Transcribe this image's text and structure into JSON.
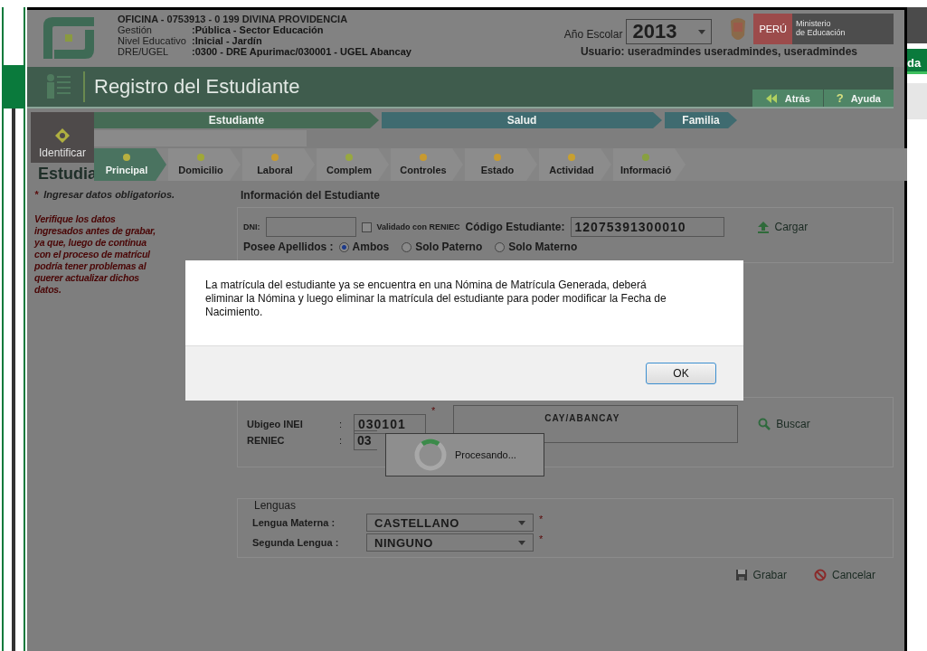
{
  "background_page": {
    "tab_text": "da"
  },
  "header": {
    "office": "OFICINA - 0753913 - 0  199 DIVINA PROVIDENCIA",
    "info": [
      {
        "label": "Gestión",
        "value": ":Pública - Sector Educación"
      },
      {
        "label": "Nivel Educativo",
        "value": ":Inicial - Jardín"
      },
      {
        "label": "DRE/UGEL",
        "value": ":0300 - DRE Apurimac/030001 - UGEL Abancay"
      }
    ],
    "year_label": "Año Escolar",
    "year": "2013",
    "logo_country": "PERÚ",
    "logo_ministry": [
      "Ministerio",
      "de Educación"
    ],
    "user": "Usuario: useradmindes useradmindes, useradmindes"
  },
  "title_bar": {
    "title": "Registro del Estudiante",
    "buttons": [
      {
        "label": "Atrás",
        "kind": "back"
      },
      {
        "label": "Ayuda",
        "kind": "help",
        "icon_text": "?"
      }
    ]
  },
  "stages": [
    {
      "label": "Estudiante",
      "selected": true
    },
    {
      "label": "Salud",
      "selected": false
    },
    {
      "label": "Familia",
      "selected": false
    }
  ],
  "identify": {
    "label": "Identificar"
  },
  "tabs": [
    {
      "label": "Principal",
      "selected": true,
      "color": "#b8b040"
    },
    {
      "label": "Domicilio",
      "selected": false,
      "color": "#a0a838"
    },
    {
      "label": "Laboral",
      "selected": false,
      "color": "#c89a30"
    },
    {
      "label": "Complem",
      "selected": false,
      "color": "#98a840"
    },
    {
      "label": "Controles",
      "selected": false,
      "color": "#c89a30"
    },
    {
      "label": "Estado",
      "selected": false,
      "color": "#c89a30"
    },
    {
      "label": "Actividad",
      "selected": false,
      "color": "#c8a030"
    },
    {
      "label": "Informació",
      "selected": false,
      "color": "#88a040"
    }
  ],
  "heading": "Estudia",
  "notes": {
    "mark": "*",
    "required": "Ingresar datos obligatorios.",
    "warning": "Verifique los datos\ningresados antes de grabar,\nya que, luego de continua\ncon el proceso de matrícul\npodría tener problemas al\nquerer actualizar dichos\ndatos."
  },
  "form": {
    "section_title": "Información del Estudiante",
    "dni_label": "DNI:",
    "reniec_check": {
      "label": "Validado con RENIEC",
      "checked": false
    },
    "code_label": "Código Estudiante:",
    "code": "12075391300010",
    "load_button": "Cargar",
    "surnames_label": "Posee Apellidos  :",
    "surname_options": [
      {
        "label": "Ambos",
        "selected": true
      },
      {
        "label": "Solo Paterno",
        "selected": false
      },
      {
        "label": "Solo Materno",
        "selected": false
      }
    ],
    "ubigeo_label": "Ubigeo INEI",
    "ubigeo": "030101",
    "place": "CAY/ABANCAY",
    "reniec_label": "RENIEC",
    "reniec": "03",
    "search_button": "Buscar",
    "languages_title": "Lenguas",
    "languages": [
      {
        "label": "Lengua Materna  :",
        "value": "CASTELLANO"
      },
      {
        "label": "Segunda Lengua  :",
        "value": "NINGUNO"
      }
    ],
    "required_mark": "*",
    "colon": ":",
    "save_button": "Grabar",
    "cancel_button": "Cancelar"
  },
  "dialog": {
    "message": "La matrícula del estudiante ya se encuentra en una Nómina de Matrícula Generada, deberá eliminar la Nómina y luego eliminar la matrícula del estudiante para poder modificar la Fecha de Nacimiento.",
    "button": "OK"
  },
  "busy": {
    "text": "Procesando..."
  }
}
